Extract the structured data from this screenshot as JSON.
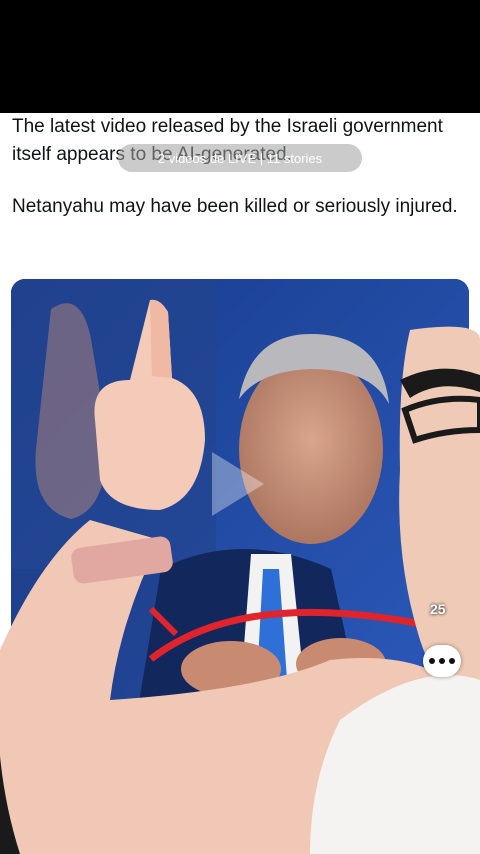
{
  "post": {
    "paragraph_1": "The latest video released by the Israeli government itself appears to be AI-generated.",
    "paragraph_2": "Netanyahu may have been killed or seriously injured."
  },
  "overlay": {
    "live_pill_text": "2 videos de LIVE | 11 stories",
    "like_count": "25"
  },
  "icons": [
    "play-icon",
    "more-icon"
  ],
  "colors": {
    "accent_red": "#e0242c",
    "blue_backdrop": "#2a58b5"
  }
}
